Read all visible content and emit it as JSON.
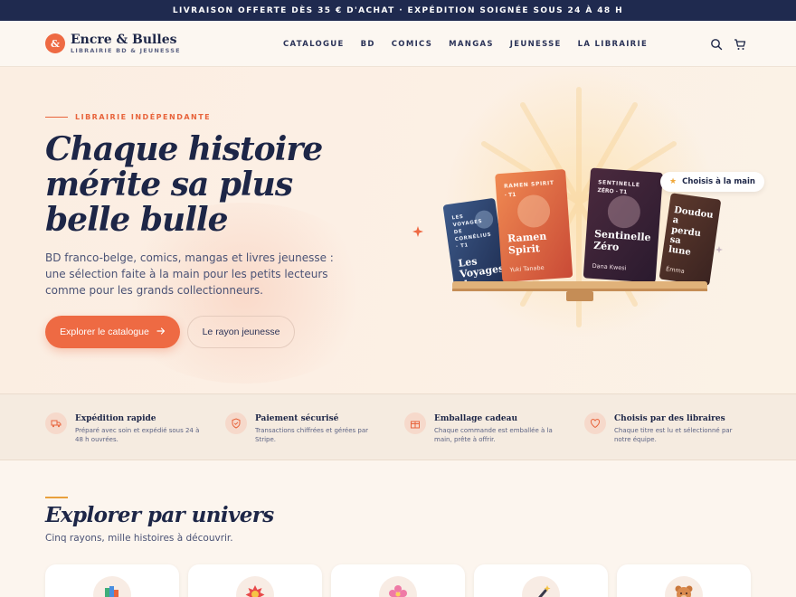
{
  "topbar": {
    "text": "LIVRAISON OFFERTE DÈS 35 € D'ACHAT · EXPÉDITION SOIGNÉE SOUS 24 À 48 H"
  },
  "brand": {
    "name": "Encre & Bulles",
    "tagline": "LIBRAIRIE BD & JEUNESSE",
    "mark": "&",
    "accent": "#ee6a43",
    "navy": "#1f2a4f"
  },
  "nav": {
    "items": [
      "CATALOGUE",
      "BD",
      "COMICS",
      "MANGAS",
      "JEUNESSE",
      "LA LIBRAIRIE"
    ]
  },
  "header_icons": [
    "search-icon",
    "cart-icon"
  ],
  "hero": {
    "eyebrow": "LIBRAIRIE INDÉPENDANTE",
    "title_lines": [
      "Chaque histoire",
      "mérite sa plus",
      "belle bulle"
    ],
    "subtitle": "BD franco-belge, comics, mangas et livres jeunesse : une sélection faite à la main pour les petits lecteurs comme pour les grands collectionneurs.",
    "primary_cta": "Explorer le catalogue",
    "secondary_cta": "Le rayon jeunesse",
    "badge": "Choisis à la main"
  },
  "books": [
    {
      "series": "LES VOYAGES DE CORNÉLIUS · T1",
      "title": "Les Voyages de",
      "author": ""
    },
    {
      "series": "RAMEN SPIRIT · T1",
      "title": "Ramen Spirit",
      "author": "Yuki Tanabe"
    },
    {
      "series": "SENTINELLE ZÉRO · T1",
      "title": "Sentinelle Zéro",
      "author": "Dana Kwesi"
    },
    {
      "series": "",
      "title": "Doudou a perdu sa lune",
      "author": "Émma"
    }
  ],
  "features": [
    {
      "icon": "truck-icon",
      "title": "Expédition rapide",
      "desc": "Préparé avec soin et expédié sous 24 à 48 h ouvrées."
    },
    {
      "icon": "shield-icon",
      "title": "Paiement sécurisé",
      "desc": "Transactions chiffrées et gérées par Stripe."
    },
    {
      "icon": "gift-icon",
      "title": "Emballage cadeau",
      "desc": "Chaque commande est emballée à la main, prête à offrir."
    },
    {
      "icon": "heart-icon",
      "title": "Choisis par des libraires",
      "desc": "Chaque titre est lu et sélectionné par notre équipe."
    }
  ],
  "universes": {
    "title": "Explorer par univers",
    "subtitle": "Cinq rayons, mille histoires à découvrir.",
    "cards": [
      {
        "icon": "books-icon"
      },
      {
        "icon": "burst-icon"
      },
      {
        "icon": "flower-icon"
      },
      {
        "icon": "magic-wand-icon"
      },
      {
        "icon": "teddy-bear-icon"
      }
    ]
  }
}
